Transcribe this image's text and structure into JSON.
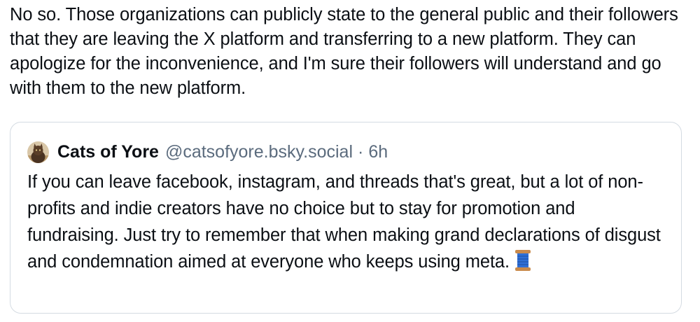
{
  "post": {
    "text": "No so. Those organizations can publicly state to the general public and their followers that they are leaving the X platform and transferring to a new platform. They can apologize for the inconvenience, and I'm sure their followers will understand and go with them to the new platform."
  },
  "quote": {
    "author_name": "Cats of Yore",
    "author_handle": "@catsofyore.bsky.social",
    "separator": "·",
    "time": "6h",
    "text": "If you can leave facebook, instagram, and threads that's great, but a lot of non-profits and indie creators have no choice but to stay for promotion and fundraising. Just try to remember that when making grand declarations of disgust and condemnation aimed at everyone who keeps using meta.",
    "avatar_icon": "cat-avatar-icon",
    "emoji_icon": "thread-spool-icon"
  },
  "colors": {
    "text": "#0b0f14",
    "muted": "#5b6b7d",
    "border": "#d4dbe2",
    "spool_thread": "#2f6fd6",
    "spool_wood": "#c98a4b"
  }
}
